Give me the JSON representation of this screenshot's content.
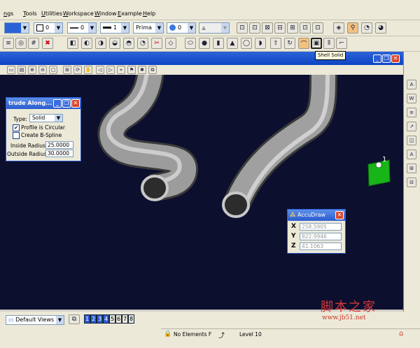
{
  "menu": [
    "ngs",
    "Tools",
    "Utilities",
    "Workspace",
    "Window",
    "Example",
    "Help"
  ],
  "toolbar1": {
    "level_value": "0",
    "weight_value": "1",
    "style_value": "0",
    "prima_value": "Prima",
    "transparency_value": "0"
  },
  "tooltip": "Shell Solid",
  "extrude_dialog": {
    "title": "trude Along...",
    "type_label": "Type:",
    "type_value": "Solid",
    "profile_circular_label": "Profile is Circular",
    "profile_circular_checked": true,
    "bspline_label": "Create B-Spline",
    "bspline_checked": false,
    "inside_radius_label": "Inside Radius:",
    "inside_radius_value": "25.0000",
    "outside_radius_label": "Outside Radius:",
    "outside_radius_value": "30.0000"
  },
  "accudraw": {
    "title": "AccuDraw",
    "x_label": "X",
    "x_value": "258.5905",
    "y_label": "Y",
    "y_value": "822.9946",
    "z_label": "Z",
    "z_value": "41.1063"
  },
  "marker_label": "1",
  "status": {
    "views_select": "Default Views",
    "pages": [
      "1",
      "2",
      "3",
      "4",
      "5",
      "6",
      "7",
      "8"
    ],
    "elements_text": "No Elements F",
    "level_text": "Level 10"
  },
  "watermark": {
    "chinese": "脚本之家",
    "url": "www.jb51.net"
  },
  "colors": {
    "viewport_bg": "#0c0f2e",
    "titlebar_blue": "#2a5bd0",
    "pipe_gray": "#b4b4b4",
    "green_marker": "#18b418"
  }
}
